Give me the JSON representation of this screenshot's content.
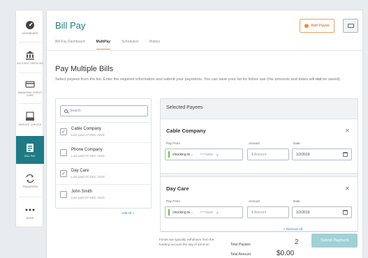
{
  "sidebar": {
    "items": [
      {
        "label": "DASHBOARD",
        "icon": "dashboard-gauge-icon"
      },
      {
        "label": "ACCOUNT SERVICES",
        "icon": "bank-icon"
      },
      {
        "label": "MANAGING CREDIT CARD",
        "icon": "credit-card-icon"
      },
      {
        "label": "DEPOSIT CHECKS",
        "icon": "deposit-check-icon"
      },
      {
        "label": "BILL PAY",
        "icon": "bill-pay-icon",
        "active": true
      },
      {
        "label": "TRANSFERS",
        "icon": "transfer-arrows-icon"
      },
      {
        "label": "MORE",
        "icon": "more-dots-icon"
      }
    ]
  },
  "header": {
    "title": "Bill Pay",
    "add_payee_label": "Add Payee",
    "tabs": [
      {
        "label": "Bill Pay Dashboard"
      },
      {
        "label": "MultiPay",
        "active": true
      },
      {
        "label": "Scheduled"
      },
      {
        "label": "History"
      }
    ]
  },
  "main": {
    "heading": "Pay Multiple Bills",
    "description": {
      "before": "Select payees from the list. Enter the required information and submit your payments. You can save your list for future use (the amounts and dates will ",
      "emphasis": "not",
      "after": " be saved)."
    }
  },
  "payee_list": {
    "search_placeholder": "Search",
    "items": [
      {
        "name": "Cable Company",
        "last_paid": "Last paid 27 DEC 2018",
        "checked": true
      },
      {
        "name": "Phone Company",
        "last_paid": "Last paid 07 DEC 2018",
        "checked": false
      },
      {
        "name": "Day Care",
        "last_paid": "Last paid 07 DEC 2018",
        "checked": true
      },
      {
        "name": "John Smith",
        "last_paid": "Last paid 07 DEC 2018",
        "checked": false
      }
    ],
    "add_all_label": "Add All »"
  },
  "selected": {
    "title": "Selected Payees",
    "payees": [
      {
        "name": "Cable Company",
        "pay_from_label": "Pay From",
        "account": "checking te...",
        "account_mask": "*****5828",
        "amount_label": "Amount",
        "amount_placeholder": "$ Amount",
        "date_label": "Date",
        "date": "1/2/2019"
      },
      {
        "name": "Day Care",
        "pay_from_label": "Pay From",
        "account": "checking te...",
        "account_mask": "*****5828",
        "amount_label": "Amount",
        "amount_placeholder": "$ Amount",
        "date_label": "Date",
        "date": "1/2/2019"
      }
    ],
    "remove_all_label": "« Remove All"
  },
  "footer": {
    "note": "Funds are typically withdrawn from the funding account the day of send-on",
    "total_payees_label": "Total Payees",
    "total_payees_value": "2",
    "total_amount_label": "Total Amount",
    "total_amount_value": "$0.00",
    "submit_label": "Submit Payment"
  },
  "colors": {
    "accent": "#1f7a86",
    "add_payee_orange": "#e8893b",
    "submit_disabled": "#9fd1d6",
    "link": "#2b7cb8"
  }
}
